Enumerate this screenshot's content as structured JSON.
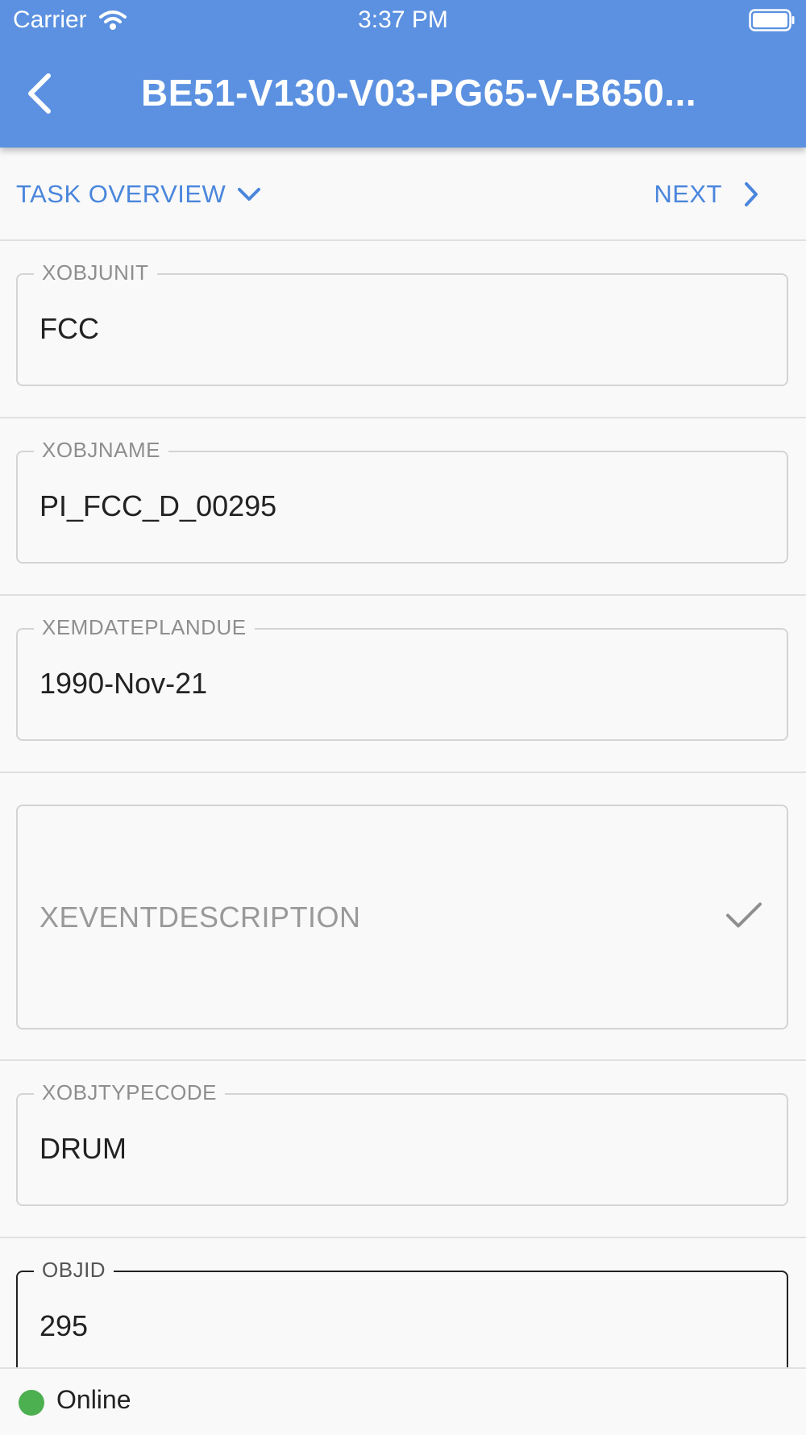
{
  "status_bar": {
    "carrier": "Carrier",
    "time": "3:37 PM",
    "wifi_icon": "wifi-icon",
    "battery_icon": "battery-icon"
  },
  "app_bar": {
    "title": "BE51-V130-V03-PG65-V-B650...",
    "back_icon": "chevron-left-icon"
  },
  "nav": {
    "task_overview_label": "TASK OVERVIEW",
    "next_label": "NEXT"
  },
  "fields": [
    {
      "label": "XOBJUNIT",
      "value": "FCC"
    },
    {
      "label": "XOBJNAME",
      "value": "PI_FCC_D_00295"
    },
    {
      "label": "XEMDATEPLANDUE",
      "value": "1990-Nov-21"
    },
    {
      "label": "XEVENTDESCRIPTION",
      "value": ""
    },
    {
      "label": "XOBJTYPECODE",
      "value": "DRUM"
    },
    {
      "label": "OBJID",
      "value": "295"
    }
  ],
  "footer": {
    "status": "Online"
  },
  "colors": {
    "accent": "#5b91e0",
    "link": "#4a86dc",
    "online": "#4caf50"
  }
}
